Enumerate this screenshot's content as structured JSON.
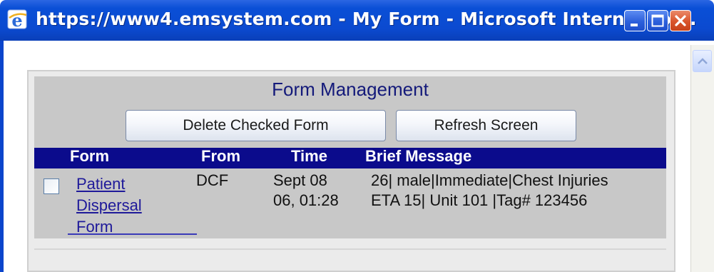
{
  "window": {
    "title": "https://www4.emsystem.com - My Form - Microsoft Internet Ex...",
    "icon": "ie-icon",
    "controls": [
      "minimize-icon",
      "maximize-icon",
      "close-icon"
    ],
    "colors": {
      "titlebar": "#0b4ad0",
      "close": "#d9542b"
    }
  },
  "form": {
    "heading": "Form Management",
    "buttons": {
      "delete_label": "Delete Checked Form",
      "refresh_label": "Refresh Screen"
    },
    "columns": [
      "Form",
      "From",
      "Time",
      "Brief Message"
    ],
    "rows": [
      {
        "checked": false,
        "form_link": "Patient Dispersal Form",
        "from": "DCF",
        "time_line1": "Sept 08",
        "time_line2": "06, 01:28",
        "message_line1": "26| male|Immediate|Chest Injuries",
        "message_line2": "ETA 15| Unit 101 |Tag# 123456"
      }
    ],
    "colors": {
      "header_bg": "#0b0b8c",
      "heading_text": "#141a7a",
      "link": "#1f1a9a"
    }
  }
}
